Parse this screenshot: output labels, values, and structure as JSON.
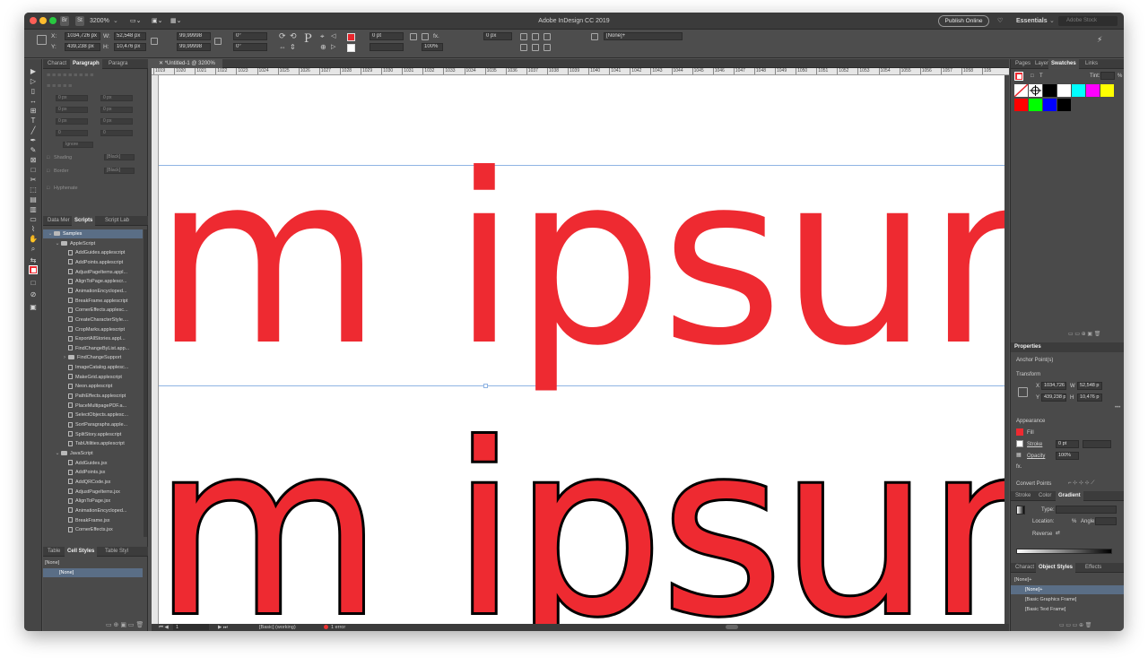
{
  "window": {
    "title": "Adobe InDesign CC 2019",
    "zoom": "3200%",
    "publish_online": "Publish Online",
    "workspace": "Essentials",
    "search_placeholder": "Adobe Stock"
  },
  "control_bar": {
    "x_label": "X:",
    "x_value": "1034,726 px",
    "y_label": "Y:",
    "y_value": "439,238 px",
    "w_label": "W:",
    "w_value": "52,548 px",
    "h_label": "H:",
    "h_value": "10,476 px",
    "scale_x": "99,99998",
    "scale_y": "99,99998",
    "rotate": "0°",
    "shear": "0°",
    "stroke_weight": "0 pt",
    "opacity": "100%",
    "spacing": "0 px",
    "object_style": "[None]+"
  },
  "left_panel": {
    "top_tabs": [
      "Charact",
      "Paragraph",
      "Paragra"
    ],
    "para_fields": [
      "0 px",
      "0 px",
      "0 px",
      "0 px",
      "0 px",
      "0 px",
      "0",
      "0"
    ],
    "ignore_label": "Ignore",
    "shading_label": "Shading",
    "border_label": "Border",
    "hyphenate_label": "Hyphenate",
    "black_label": "[Black]",
    "scripts_tabs": [
      "Data Mer",
      "Scripts",
      "Script Lab"
    ],
    "scripts": [
      {
        "label": "Samples",
        "type": "folder",
        "indent": 1
      },
      {
        "label": "AppleScript",
        "type": "folder",
        "indent": 2
      },
      {
        "label": "AddGuides.applescript",
        "type": "script",
        "indent": 3
      },
      {
        "label": "AddPoints.applescript",
        "type": "script",
        "indent": 3
      },
      {
        "label": "AdjustPageItems.appl...",
        "type": "script",
        "indent": 3
      },
      {
        "label": "AlignToPage.applescr...",
        "type": "script",
        "indent": 3
      },
      {
        "label": "AnimationEncycloped...",
        "type": "script",
        "indent": 3
      },
      {
        "label": "BreakFrame.applescript",
        "type": "script",
        "indent": 3
      },
      {
        "label": "CornerEffects.applesc...",
        "type": "script",
        "indent": 3
      },
      {
        "label": "CreateCharacterStyle....",
        "type": "script",
        "indent": 3
      },
      {
        "label": "CropMarks.applescript",
        "type": "script",
        "indent": 3
      },
      {
        "label": "ExportAllStories.appl...",
        "type": "script",
        "indent": 3
      },
      {
        "label": "FindChangeByList.app...",
        "type": "script",
        "indent": 3
      },
      {
        "label": "FindChangeSupport",
        "type": "folder",
        "indent": 3
      },
      {
        "label": "ImageCatalog.applesc...",
        "type": "script",
        "indent": 3
      },
      {
        "label": "MakeGrid.applescript",
        "type": "script",
        "indent": 3
      },
      {
        "label": "Neon.applescript",
        "type": "script",
        "indent": 3
      },
      {
        "label": "PathEffects.applescript",
        "type": "script",
        "indent": 3
      },
      {
        "label": "PlaceMultipagePDF.a...",
        "type": "script",
        "indent": 3
      },
      {
        "label": "SelectObjects.applesc...",
        "type": "script",
        "indent": 3
      },
      {
        "label": "SortParagraphs.apple...",
        "type": "script",
        "indent": 3
      },
      {
        "label": "SplitStory.applescript",
        "type": "script",
        "indent": 3
      },
      {
        "label": "TabUtilities.applescript",
        "type": "script",
        "indent": 3
      },
      {
        "label": "JavaScript",
        "type": "folder",
        "indent": 2
      },
      {
        "label": "AddGuides.jsx",
        "type": "script",
        "indent": 3
      },
      {
        "label": "AddPoints.jsx",
        "type": "script",
        "indent": 3
      },
      {
        "label": "AddQRCode.jsx",
        "type": "script",
        "indent": 3
      },
      {
        "label": "AdjustPageItems.jsx",
        "type": "script",
        "indent": 3
      },
      {
        "label": "AlignToPage.jsx",
        "type": "script",
        "indent": 3
      },
      {
        "label": "AnimationEncycloped...",
        "type": "script",
        "indent": 3
      },
      {
        "label": "BreakFrame.jsx",
        "type": "script",
        "indent": 3
      },
      {
        "label": "CornerEffects.jsx",
        "type": "script",
        "indent": 3
      }
    ],
    "cell_tabs": [
      "Table",
      "Cell Styles",
      "Table Styl"
    ],
    "cell_style_header": "[None]",
    "cell_style_selected": "[None]"
  },
  "document": {
    "tab_label": "*Untitled-1 @ 3200%",
    "ruler_labels": [
      "1019",
      "1020",
      "1021",
      "1022",
      "1023",
      "1024",
      "1025",
      "1026",
      "1027",
      "1028",
      "1029",
      "1030",
      "1031",
      "1032",
      "1033",
      "1034",
      "1035",
      "1036",
      "1037",
      "1038",
      "1039",
      "1040",
      "1041",
      "1042",
      "1043",
      "1044",
      "1045",
      "1046",
      "1047",
      "1048",
      "1049",
      "1050",
      "1051",
      "1052",
      "1053",
      "1054",
      "1055",
      "1056",
      "1057",
      "1058",
      "105"
    ],
    "text_top": "m ipsum",
    "text_bottom": "m ipsum"
  },
  "status_bar": {
    "page": "1",
    "style": "[Basic] (working)",
    "errors": "1 error"
  },
  "right_panel": {
    "top_tabs": [
      "Pages",
      "Layer",
      "Swatches",
      "Links"
    ],
    "tint_label": "Tint:",
    "tint_unit": "%",
    "swatch_colors": [
      "#ffffff",
      "#ffffff",
      "#000000",
      "#ffffff",
      "#00ffff",
      "#ff00ff",
      "#ffff00",
      "#ff0000",
      "#00ff00",
      "#0000ff",
      "#000000"
    ],
    "properties_header": "Properties",
    "anchor_point": "Anchor Point(s)",
    "transform_label": "Transform",
    "x_label": "X",
    "x_value": "1034,726",
    "y_label": "Y",
    "y_value": "439,238 p",
    "w_label": "W",
    "w_value": "52,548 p",
    "h_label": "H",
    "h_value": "10,476 p",
    "appearance_label": "Appearance",
    "fill_label": "Fill",
    "stroke_label": "Stroke",
    "stroke_value": "0 pt",
    "opacity_label": "Opacity",
    "opacity_value": "100%",
    "fx_label": "fx.",
    "convert_points": "Convert Points",
    "gradient_tabs": [
      "Stroke",
      "Color",
      "Gradient"
    ],
    "type_label": "Type:",
    "location_label": "Location:",
    "location_unit": "%",
    "angle_label": "Angle:",
    "reverse_label": "Reverse",
    "object_tabs": [
      "Charact",
      "Object Styles",
      "Effects"
    ],
    "object_styles": [
      "[None]+",
      "[None]+",
      "[Basic Graphics Frame]",
      "[Basic Text Frame]"
    ]
  },
  "colors": {
    "accent_red": "#ee2a31",
    "guide_blue": "#8fb4e3",
    "selection": "#5a6e86"
  }
}
